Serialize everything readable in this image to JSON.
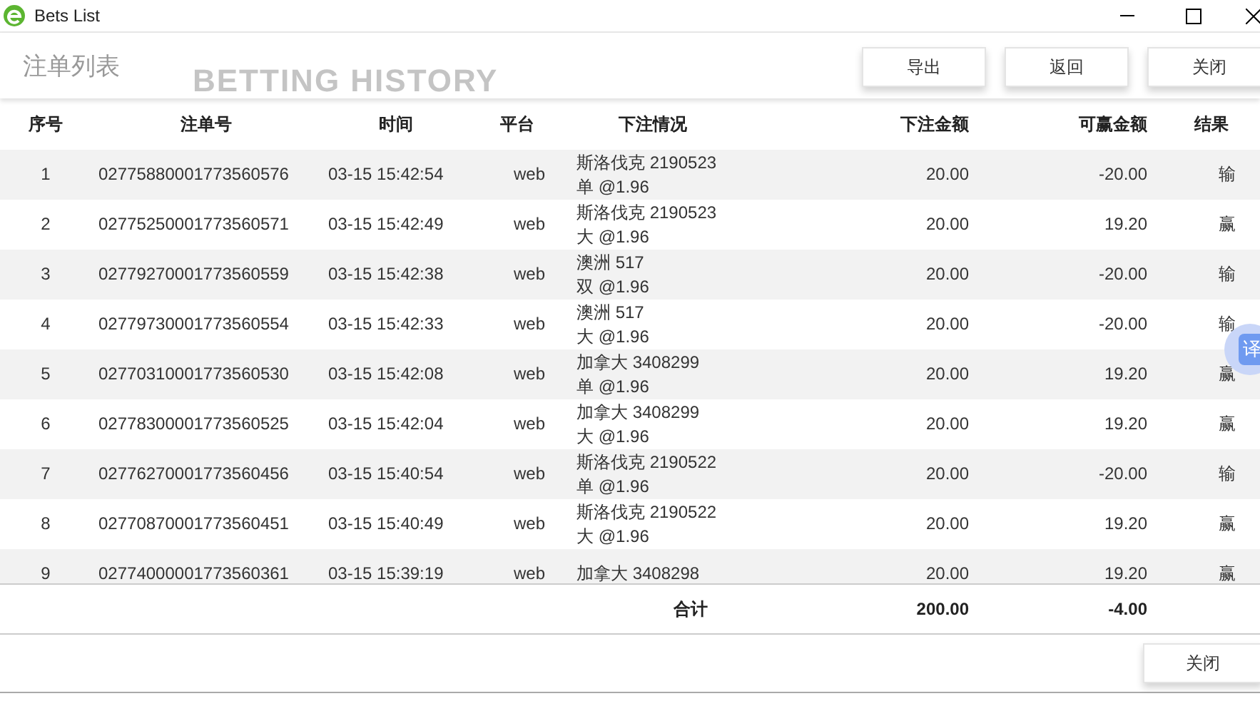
{
  "window": {
    "title": "Bets List"
  },
  "header": {
    "title": "注单列表",
    "subtitle": "BETTING HISTORY",
    "buttons": [
      "导出",
      "返回",
      "关闭"
    ]
  },
  "table": {
    "columns": [
      "序号",
      "注单号",
      "时间",
      "平台",
      "下注情况",
      "下注金额",
      "可赢金额",
      "结果"
    ],
    "rows": [
      {
        "no": "1",
        "id": "02775880001773560576",
        "time": "03-15 15:42:54",
        "platform": "web",
        "bet": [
          "斯洛伐克 2190523",
          "单 @1.96"
        ],
        "stake": "20.00",
        "win": "-20.00",
        "result": "输"
      },
      {
        "no": "2",
        "id": "02775250001773560571",
        "time": "03-15 15:42:49",
        "platform": "web",
        "bet": [
          "斯洛伐克 2190523",
          "大 @1.96"
        ],
        "stake": "20.00",
        "win": "19.20",
        "result": "赢"
      },
      {
        "no": "3",
        "id": "02779270001773560559",
        "time": "03-15 15:42:38",
        "platform": "web",
        "bet": [
          "澳洲 517",
          "双 @1.96"
        ],
        "stake": "20.00",
        "win": "-20.00",
        "result": "输"
      },
      {
        "no": "4",
        "id": "02779730001773560554",
        "time": "03-15 15:42:33",
        "platform": "web",
        "bet": [
          "澳洲 517",
          "大 @1.96"
        ],
        "stake": "20.00",
        "win": "-20.00",
        "result": "输"
      },
      {
        "no": "5",
        "id": "02770310001773560530",
        "time": "03-15 15:42:08",
        "platform": "web",
        "bet": [
          "加拿大 3408299",
          "单 @1.96"
        ],
        "stake": "20.00",
        "win": "19.20",
        "result": "赢"
      },
      {
        "no": "6",
        "id": "02778300001773560525",
        "time": "03-15 15:42:04",
        "platform": "web",
        "bet": [
          "加拿大 3408299",
          "大 @1.96"
        ],
        "stake": "20.00",
        "win": "19.20",
        "result": "赢"
      },
      {
        "no": "7",
        "id": "02776270001773560456",
        "time": "03-15 15:40:54",
        "platform": "web",
        "bet": [
          "斯洛伐克 2190522",
          "单 @1.96"
        ],
        "stake": "20.00",
        "win": "-20.00",
        "result": "输"
      },
      {
        "no": "8",
        "id": "02770870001773560451",
        "time": "03-15 15:40:49",
        "platform": "web",
        "bet": [
          "斯洛伐克 2190522",
          "大 @1.96"
        ],
        "stake": "20.00",
        "win": "19.20",
        "result": "赢"
      },
      {
        "no": "9",
        "id": "02774000001773560361",
        "time": "03-15 15:39:19",
        "platform": "web",
        "bet": [
          "加拿大 3408298"
        ],
        "stake": "20.00",
        "win": "19.20",
        "result": "赢"
      }
    ],
    "totals": {
      "label": "合计",
      "stake": "200.00",
      "win": "-4.00"
    }
  },
  "translate_button": {
    "label": "译"
  },
  "footer": {
    "button": "关闭"
  }
}
